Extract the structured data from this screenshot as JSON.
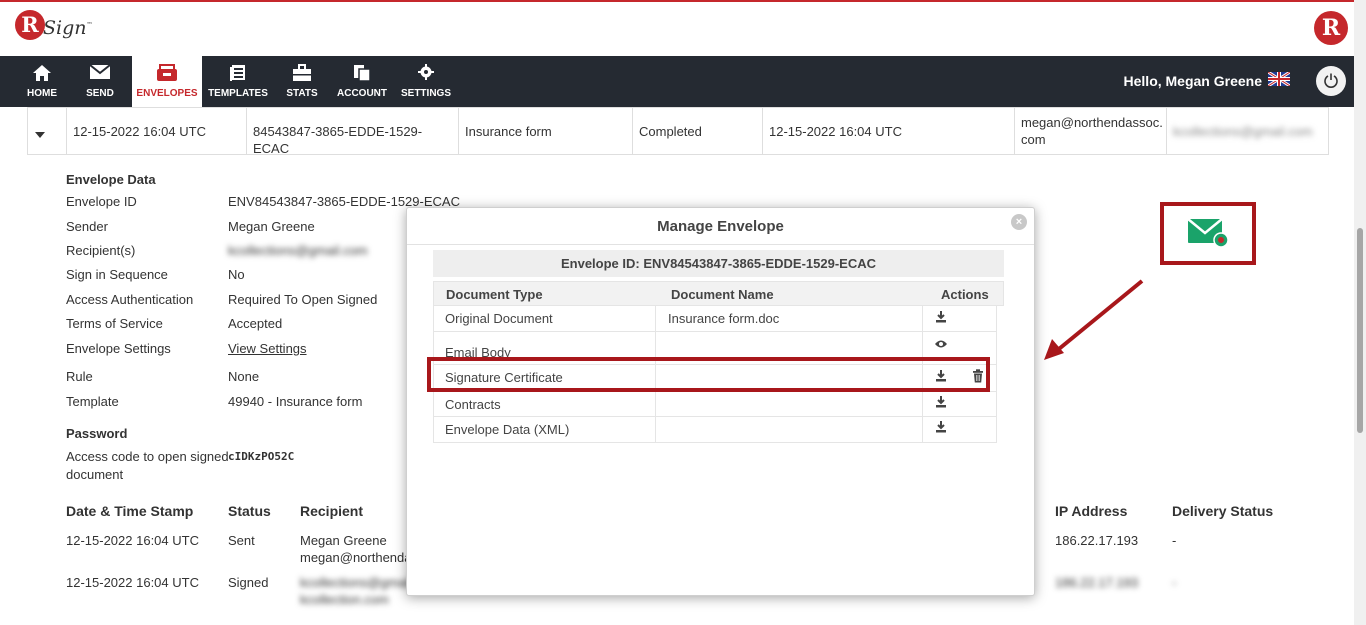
{
  "header": {
    "logo_letter": "R",
    "logo_word": "Sign",
    "logo_tm": "™",
    "right_logo": "R",
    "greeting": "Hello, Megan Greene"
  },
  "nav": {
    "items": [
      {
        "label": "HOME",
        "icon": "home-icon"
      },
      {
        "label": "SEND",
        "icon": "envelope-icon"
      },
      {
        "label": "ENVELOPES",
        "icon": "inbox-icon",
        "active": true
      },
      {
        "label": "TEMPLATES",
        "icon": "templates-icon"
      },
      {
        "label": "STATS",
        "icon": "briefcase-icon"
      },
      {
        "label": "ACCOUNT",
        "icon": "account-icon"
      },
      {
        "label": "SETTINGS",
        "icon": "gear-icon"
      }
    ]
  },
  "envelope_row": {
    "sent_date": "12-15-2022 16:04 UTC",
    "envelope_code": "84543847-3865-EDDE-1529-ECAC",
    "subject": "Insurance form",
    "status": "Completed",
    "completed_date": "12-15-2022 16:04 UTC",
    "sender_email": "megan@northendassoc. com",
    "recipient_email": "kcollections@gmail.com"
  },
  "envelope_data": {
    "title": "Envelope Data",
    "fields": [
      {
        "label": "Envelope ID",
        "value": "ENV84543847-3865-EDDE-1529-ECAC"
      },
      {
        "label": "Sender",
        "value": "Megan Greene"
      },
      {
        "label": "Recipient(s)",
        "value": "kcollections@gmail.com"
      },
      {
        "label": "Sign in Sequence",
        "value": "No"
      },
      {
        "label": "Access Authentication",
        "value": "Required To Open Signed"
      },
      {
        "label": "Terms of Service",
        "value": "Accepted"
      },
      {
        "label": "Envelope Settings",
        "value": "View Settings"
      },
      {
        "label": "Rule",
        "value": "None"
      },
      {
        "label": "Template",
        "value": "49940 - Insurance form"
      }
    ]
  },
  "password": {
    "title": "Password",
    "label_line1": "Access code to open signed",
    "label_line2": "document",
    "code": "cIDKzPO52C"
  },
  "history": {
    "headers": [
      "Date & Time Stamp",
      "Status",
      "Recipient",
      "IP Address",
      "Delivery Status"
    ],
    "rows": [
      {
        "date": "12-15-2022 16:04 UTC",
        "status": "Sent",
        "recipient_name": "Megan Greene",
        "recipient_email": "megan@northenda",
        "ip": "186.22.17.193",
        "delivery": "-"
      },
      {
        "date": "12-15-2022 16:04 UTC",
        "status": "Signed",
        "recipient_name": "kcollections@gmail",
        "recipient_email": "kcollection.com",
        "ip": "186.22.17.193",
        "delivery": "-"
      }
    ]
  },
  "modal": {
    "title": "Manage Envelope",
    "envelope_id_label": "Envelope ID: ENV84543847-3865-EDDE-1529-ECAC",
    "columns": [
      "Document Type",
      "Document Name",
      "Actions"
    ],
    "rows": [
      {
        "type": "Original Document",
        "name": "Insurance form.doc",
        "actions": [
          "download-icon"
        ]
      },
      {
        "type": "Email Body",
        "name": "",
        "actions": [
          "eye-icon"
        ]
      },
      {
        "type": "Signature Certificate",
        "name": "",
        "actions": [
          "download-icon",
          "trash-icon"
        ]
      },
      {
        "type": "Contracts",
        "name": "",
        "actions": [
          "download-icon"
        ]
      },
      {
        "type": "Envelope Data (XML)",
        "name": "",
        "actions": [
          "download-icon"
        ]
      }
    ]
  },
  "colors": {
    "brand_red": "#c5282c",
    "nav_bg": "#252a32",
    "annotation_red": "#a8171b",
    "envelope_green": "#1aa36a"
  }
}
